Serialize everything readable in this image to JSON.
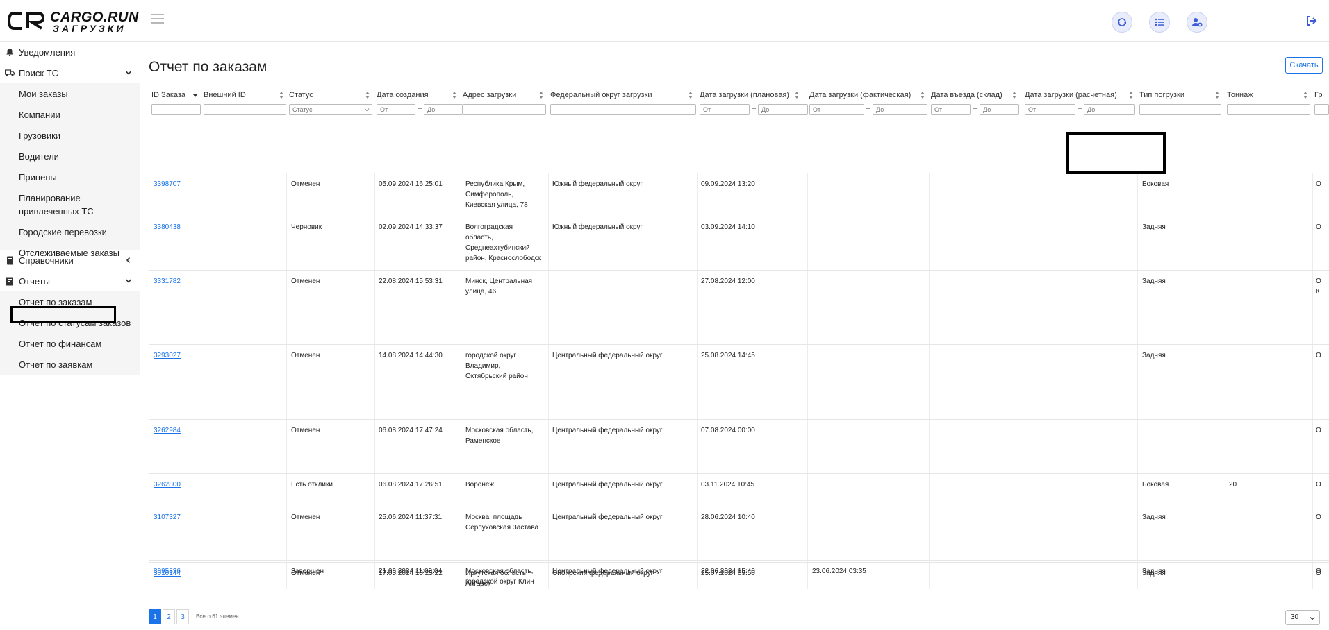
{
  "brand": {
    "name": "CARGO.RUN",
    "sub": "ЗАГРУЗКИ"
  },
  "sidebar": {
    "items": [
      {
        "label": "Уведомления",
        "icon": "bell-icon"
      },
      {
        "label": "Поиск ТС",
        "icon": "truck-icon"
      },
      {
        "label": "Справочники",
        "icon": "book-icon"
      },
      {
        "label": "Отчеты",
        "icon": "report-icon"
      }
    ],
    "search_sub": [
      "Мои заказы",
      "Компании",
      "Грузовики",
      "Водители",
      "Прицепы",
      "Планирование",
      "привлеченных ТС",
      "Городские перевозки",
      "Отслеживаемые заказы"
    ],
    "reports_sub": [
      "Отчет по заказам",
      "Отчет по статусам заказов",
      "Отчет по финансам",
      "Отчет по заявкам"
    ]
  },
  "page": {
    "title": "Отчет по заказам",
    "download": "Скачать"
  },
  "columns": [
    "ID Заказа",
    "Внешний ID",
    "Статус",
    "Дата создания",
    "Адрес загрузки",
    "Федеральный округ загрузки",
    "Дата загрузки (плановая)",
    "Дата загрузки (фактическая)",
    "Дата въезда (склад)",
    "Дата загрузки (расчетная)",
    "Тип погрузки",
    "Тоннаж",
    "Гр"
  ],
  "filters": {
    "status_placeholder": "Статус",
    "from": "От",
    "to": "До",
    "dash": "–"
  },
  "rows": [
    {
      "id": "3398707",
      "status": "Отменен",
      "created": "05.09.2024 16:25:01",
      "address": [
        "Республика Крым,",
        "Симферополь,",
        "Киевская улица, 78"
      ],
      "district": "Южный федеральный округ",
      "planned": "09.09.2024 13:20",
      "actual": "",
      "loading_type": "Боковая",
      "tonnage": "",
      "extra": [
        "О"
      ]
    },
    {
      "id": "3380438",
      "status": "Черновик",
      "created": "02.09.2024 14:33:37",
      "address": [
        "Волгоградская",
        "область,",
        "Среднеахтубинский",
        "район, Краснослободск"
      ],
      "district": "Южный федеральный округ",
      "planned": "03.09.2024 14:10",
      "actual": "",
      "loading_type": "Задняя",
      "tonnage": "",
      "extra": [
        "О"
      ]
    },
    {
      "id": "3331782",
      "status": "Отменен",
      "created": "22.08.2024 15:53:31",
      "address": [
        "Минск, Центральная",
        "улица, 46"
      ],
      "district": "",
      "planned": "27.08.2024 12:00",
      "actual": "",
      "loading_type": "Задняя",
      "tonnage": "",
      "extra": [
        "О",
        "К"
      ]
    },
    {
      "id": "3293027",
      "status": "Отменен",
      "created": "14.08.2024 14:44:30",
      "address": [
        "городской округ",
        "Владимир,",
        "Октябрьский район"
      ],
      "district": "Центральный федеральный округ",
      "planned": "25.08.2024 14:45",
      "actual": "",
      "loading_type": "Задняя",
      "tonnage": "",
      "extra": [
        "О"
      ]
    },
    {
      "id": "3262984",
      "status": "Отменен",
      "created": "06.08.2024 17:47:24",
      "address": [
        "Московская область,",
        "Раменское"
      ],
      "district": "Центральный федеральный округ",
      "planned": "07.08.2024 00:00",
      "actual": "",
      "loading_type": "",
      "tonnage": "",
      "extra": [
        "О"
      ]
    },
    {
      "id": "3262800",
      "status": "Есть отклики",
      "created": "06.08.2024 17:26:51",
      "address": [
        "Воронеж"
      ],
      "district": "Центральный федеральный округ",
      "planned": "03.11.2024 10:45",
      "actual": "",
      "loading_type": "Боковая",
      "tonnage": "20",
      "extra": [
        "О"
      ]
    },
    {
      "id": "3107327",
      "status": "Отменен",
      "created": "25.06.2024 11:37:31",
      "address": [
        "Москва, площадь",
        "Серпуховская Застава"
      ],
      "district": "Центральный федеральный округ",
      "planned": "28.06.2024 10:40",
      "actual": "",
      "loading_type": "Задняя",
      "tonnage": "",
      "extra": [
        "О"
      ]
    },
    {
      "id": "3095836",
      "status": "Завершен",
      "created": "21.06.2024 11:03:04",
      "address": [
        "Московская область,",
        "городской округ Клин"
      ],
      "district": "Центральный федеральный округ",
      "planned": "22.06.2024 15:40",
      "actual": "23.06.2024 03:35",
      "loading_type": "Задняя",
      "tonnage": "",
      "extra": [
        "О"
      ]
    },
    {
      "id": "3010144",
      "status": "Отменен",
      "created": "17.05.2024 10:25:22",
      "address": [
        "Иркутская область,",
        "Ангарск"
      ],
      "district": "Сибирский федеральный округ",
      "planned": "25.07.2024 09:50",
      "actual": "",
      "loading_type": "Задняя",
      "tonnage": "",
      "extra": [
        "О"
      ]
    }
  ],
  "pagination": {
    "pages": [
      "1",
      "2",
      "3"
    ],
    "current": "1",
    "total_label": "Всего 61 элемент",
    "page_size": "30"
  }
}
